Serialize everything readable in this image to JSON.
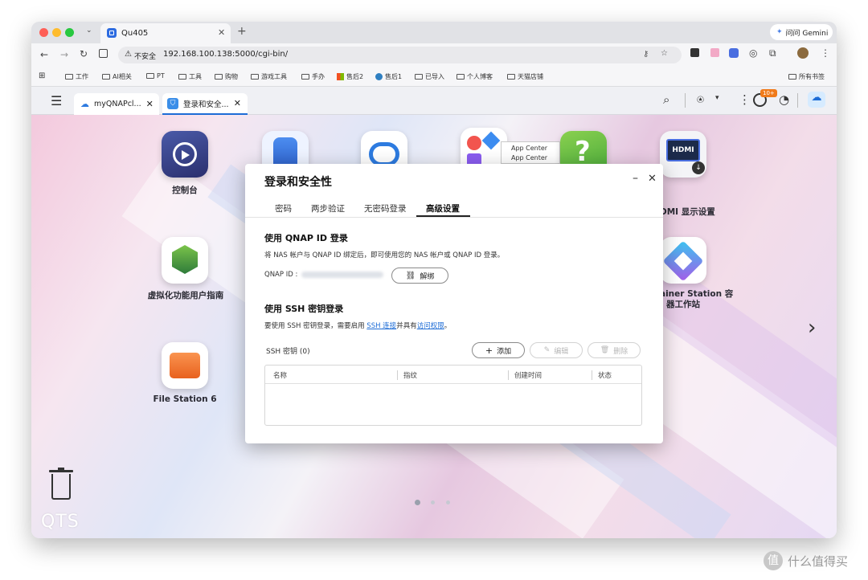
{
  "browser": {
    "tab_title": "Qu405",
    "gemini_button": "问问 Gemini",
    "security_label": "不安全",
    "url": "192.168.100.138:5000/cgi-bin/",
    "bookmarks": [
      "工作",
      "AI相关",
      "PT",
      "工具",
      "购物",
      "游戏工具",
      "手办",
      "售后2",
      "售后1",
      "已导入",
      "个人博客",
      "天猫店铺"
    ],
    "all_bookmarks": "所有书签"
  },
  "qts": {
    "tabs": [
      "myQNAPcl...",
      "登录和安全..."
    ],
    "badge": "10+",
    "logo": "QTS"
  },
  "desktop": {
    "icons": [
      {
        "label": "控制台"
      },
      {
        "label": "虚拟化功能用户指南"
      },
      {
        "label": "File Station 6"
      },
      {
        "label": "DMI 显示设置"
      },
      {
        "label_line1": "ainer Station 容",
        "label_line2": "器工作站"
      }
    ],
    "tooltip": [
      "App Center",
      "App Center"
    ],
    "hdmi_text": "HDMI"
  },
  "dialog": {
    "title": "登录和安全性",
    "tabs": [
      "密码",
      "两步验证",
      "无密码登录",
      "高级设置"
    ],
    "active_tab": "高级设置",
    "qnap_section": {
      "title": "使用 QNAP ID 登录",
      "desc": "将 NAS 帐户与 QNAP ID 绑定后，即可使用您的 NAS 帐户或 QNAP ID 登录。",
      "id_label": "QNAP ID :",
      "unbind_button": "解绑"
    },
    "ssh_section": {
      "title": "使用 SSH 密钥登录",
      "desc_prefix": "要使用 SSH 密钥登录，需要启用",
      "link1": "SSH 连接",
      "desc_mid": "并具有",
      "link2": "访问权限",
      "desc_suffix": "。",
      "count_label": "SSH 密钥 (0)",
      "add_button": "添加",
      "edit_button": "编辑",
      "delete_button": "删除",
      "columns": [
        "名称",
        "指纹",
        "创建时间",
        "状态"
      ]
    }
  },
  "watermark": "什么值得买"
}
